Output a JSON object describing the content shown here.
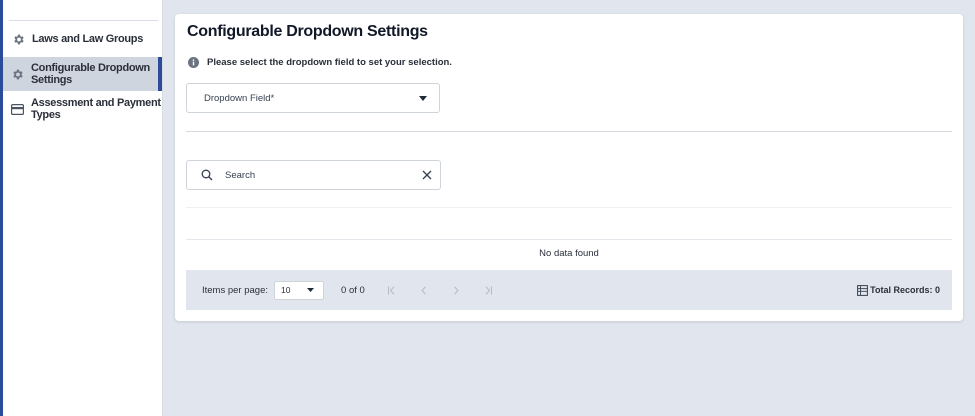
{
  "sidebar": {
    "items": [
      {
        "label": "Laws and Law Groups",
        "icon": "gear-icon",
        "active": false
      },
      {
        "label": "Configurable Dropdown Settings",
        "icon": "gear-icon",
        "active": true
      },
      {
        "label": "Assessment and Payment Types",
        "icon": "card-icon",
        "active": false
      }
    ]
  },
  "main": {
    "title": "Configurable Dropdown Settings",
    "info_text": "Please select the dropdown field to set your selection.",
    "dropdown_label": "Dropdown Field*",
    "search_placeholder": "Search",
    "search_value": "",
    "empty_message": "No data found"
  },
  "paginator": {
    "items_per_page_label": "Items per page:",
    "items_per_page_value": "10",
    "range_label": "0 of 0",
    "total_label": "Total Records: 0"
  },
  "colors": {
    "accent": "#2b4c9a",
    "background": "#e1e6ee",
    "active_item": "#cfd5df"
  }
}
